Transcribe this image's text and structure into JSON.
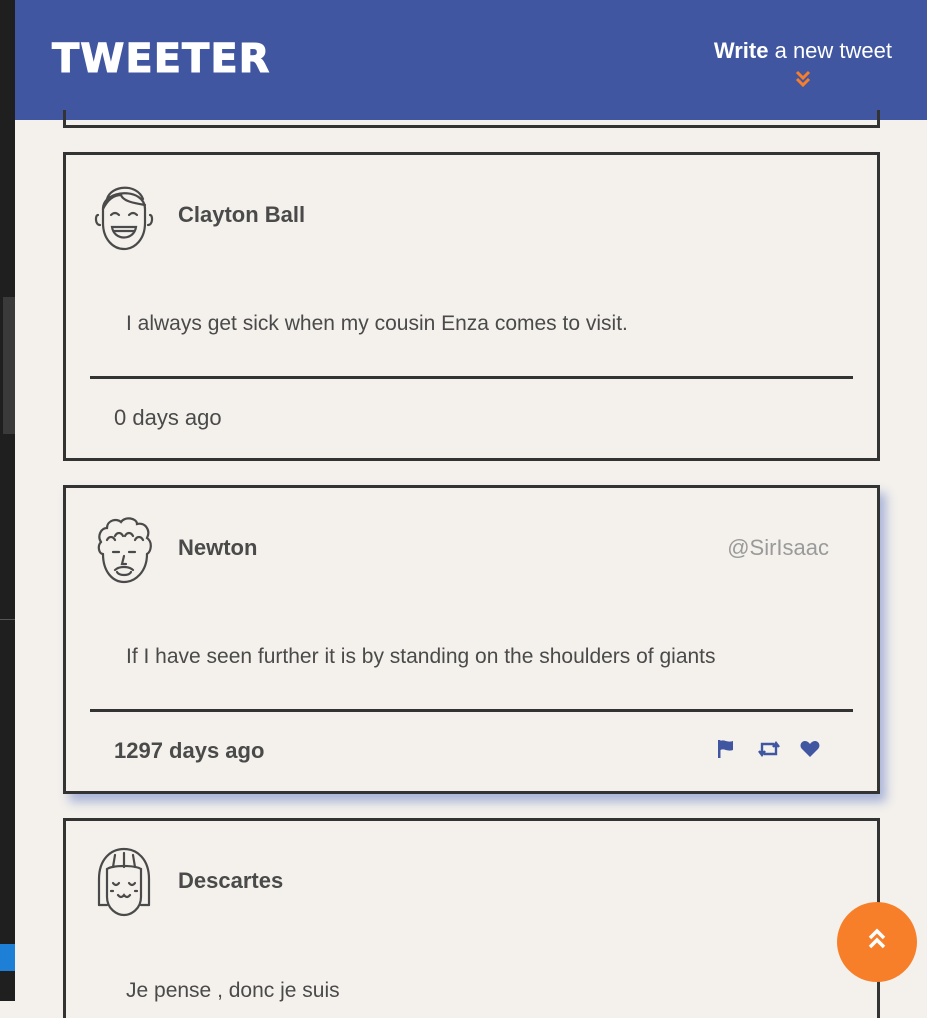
{
  "header": {
    "logo": "TWEETER",
    "compose_bold": "Write",
    "compose_rest": " a new tweet",
    "compose_icon": "chevron-double-down-icon"
  },
  "colors": {
    "nav_bg": "#4056a1",
    "page_bg": "#f4f1ec",
    "accent": "#f77f2a",
    "action_icon": "#4056a1",
    "card_border": "#333333",
    "shadow": "#a9b4d8"
  },
  "tweets": [
    {
      "name": "Clayton Ball",
      "handle": "",
      "avatar_icon": "smiling-boy-avatar-icon",
      "text": "I always get sick when my cousin Enza comes to visit.",
      "age": "0 days ago"
    },
    {
      "name": "Newton",
      "handle": "@SirIsaac",
      "avatar_icon": "curly-hair-avatar-icon",
      "text": "If I have seen further it is by standing on the shoulders of giants",
      "age": "1297 days ago",
      "actions": [
        "flag-icon",
        "retweet-icon",
        "heart-icon"
      ]
    },
    {
      "name": "Descartes",
      "handle": "",
      "avatar_icon": "bob-hair-avatar-icon",
      "text": "Je pense , donc je suis",
      "age": ""
    }
  ],
  "scroll_top": {
    "icon": "chevron-double-up-icon",
    "glyph": "«"
  }
}
